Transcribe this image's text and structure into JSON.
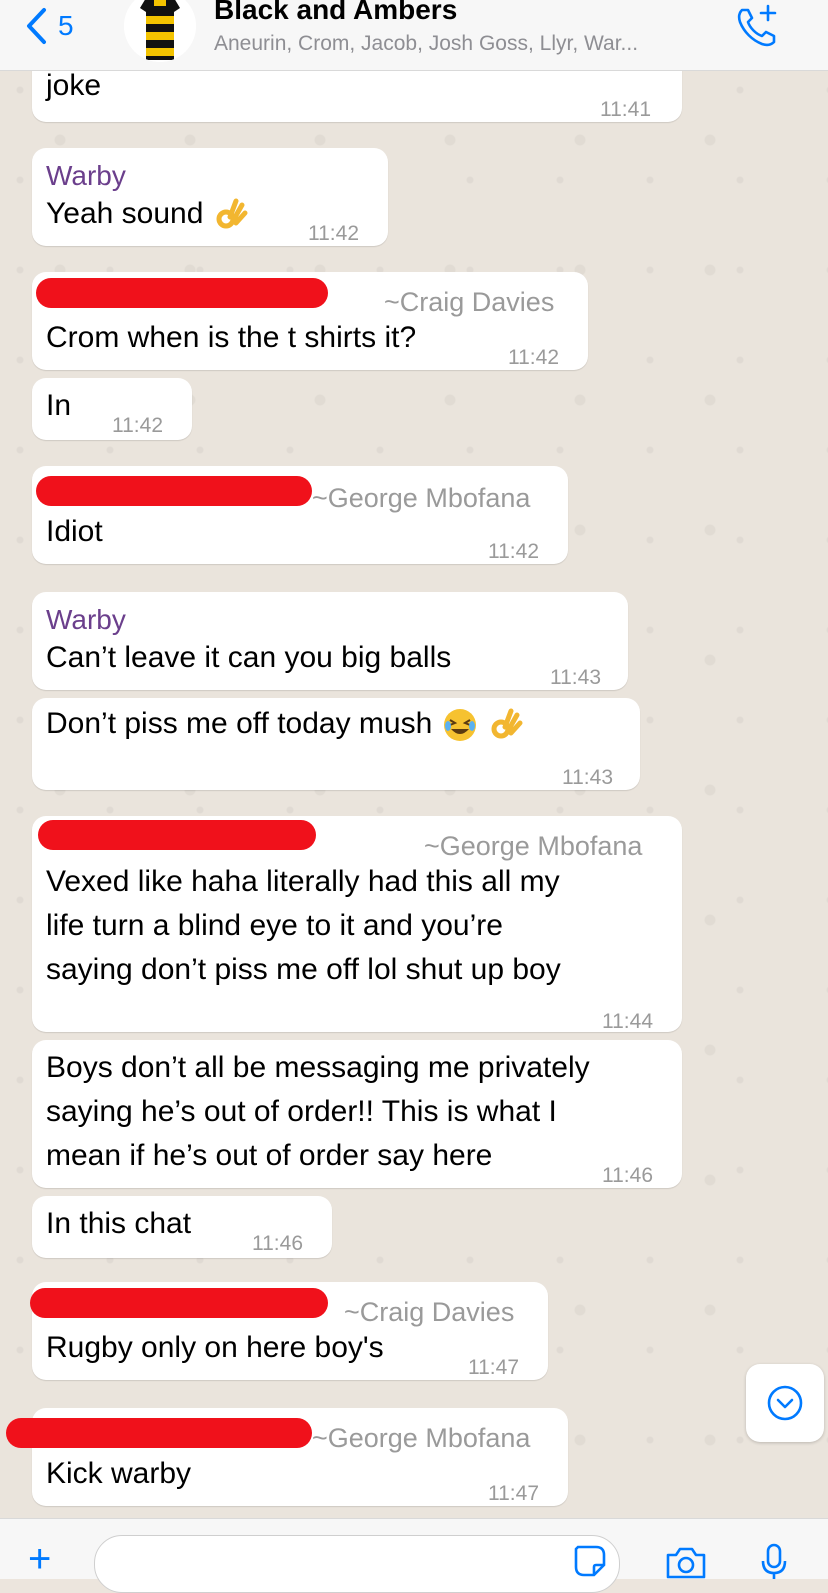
{
  "header": {
    "back_count": "5",
    "title": "Black and Ambers",
    "members": "Aneurin, Crom, Jacob, Josh Goss, Llyr, War..."
  },
  "messages": [
    {
      "text": "joke",
      "time": "11:41"
    },
    {
      "sender": "Warby",
      "text": "Yeah sound",
      "time": "11:42"
    },
    {
      "sender": "~Craig Davies",
      "text": "Crom when is the t shirts it?",
      "time": "11:42"
    },
    {
      "text": "In",
      "time": "11:42"
    },
    {
      "sender": "~George Mbofana",
      "text": "Idiot",
      "time": "11:42"
    },
    {
      "sender": "Warby",
      "text": "Can’t leave it can you big balls",
      "time": "11:43"
    },
    {
      "text": "Don’t piss me off today mush",
      "time": "11:43"
    },
    {
      "sender": "~George Mbofana",
      "lines": [
        "Vexed like haha literally had this all my",
        "life turn a blind eye to it and you’re",
        "saying don’t piss me off lol shut up boy"
      ],
      "time": "11:44"
    },
    {
      "lines": [
        "Boys don’t all be messaging me privately",
        "saying he’s out of order!! This is what I",
        "mean if he’s out of order say here"
      ],
      "time": "11:46"
    },
    {
      "text": "In this chat",
      "time": "11:46"
    },
    {
      "sender": "~Craig Davies",
      "text": "Rugby only on here boy's",
      "time": "11:47"
    },
    {
      "sender": "~George Mbofana",
      "text": "Kick warby",
      "time": "11:47"
    }
  ],
  "colors": {
    "accent": "#007aff",
    "sender_named": "#6b3f8c",
    "redaction": "#f0111b",
    "bubble": "#ffffff",
    "chat_background": "#eae4dc"
  },
  "icons": [
    "chevron-left-icon",
    "call-add-icon",
    "chevron-down-icon",
    "plus-icon",
    "sticker-icon",
    "camera-icon",
    "microphone-icon",
    "ok-hand-emoji",
    "laughing-emoji"
  ]
}
